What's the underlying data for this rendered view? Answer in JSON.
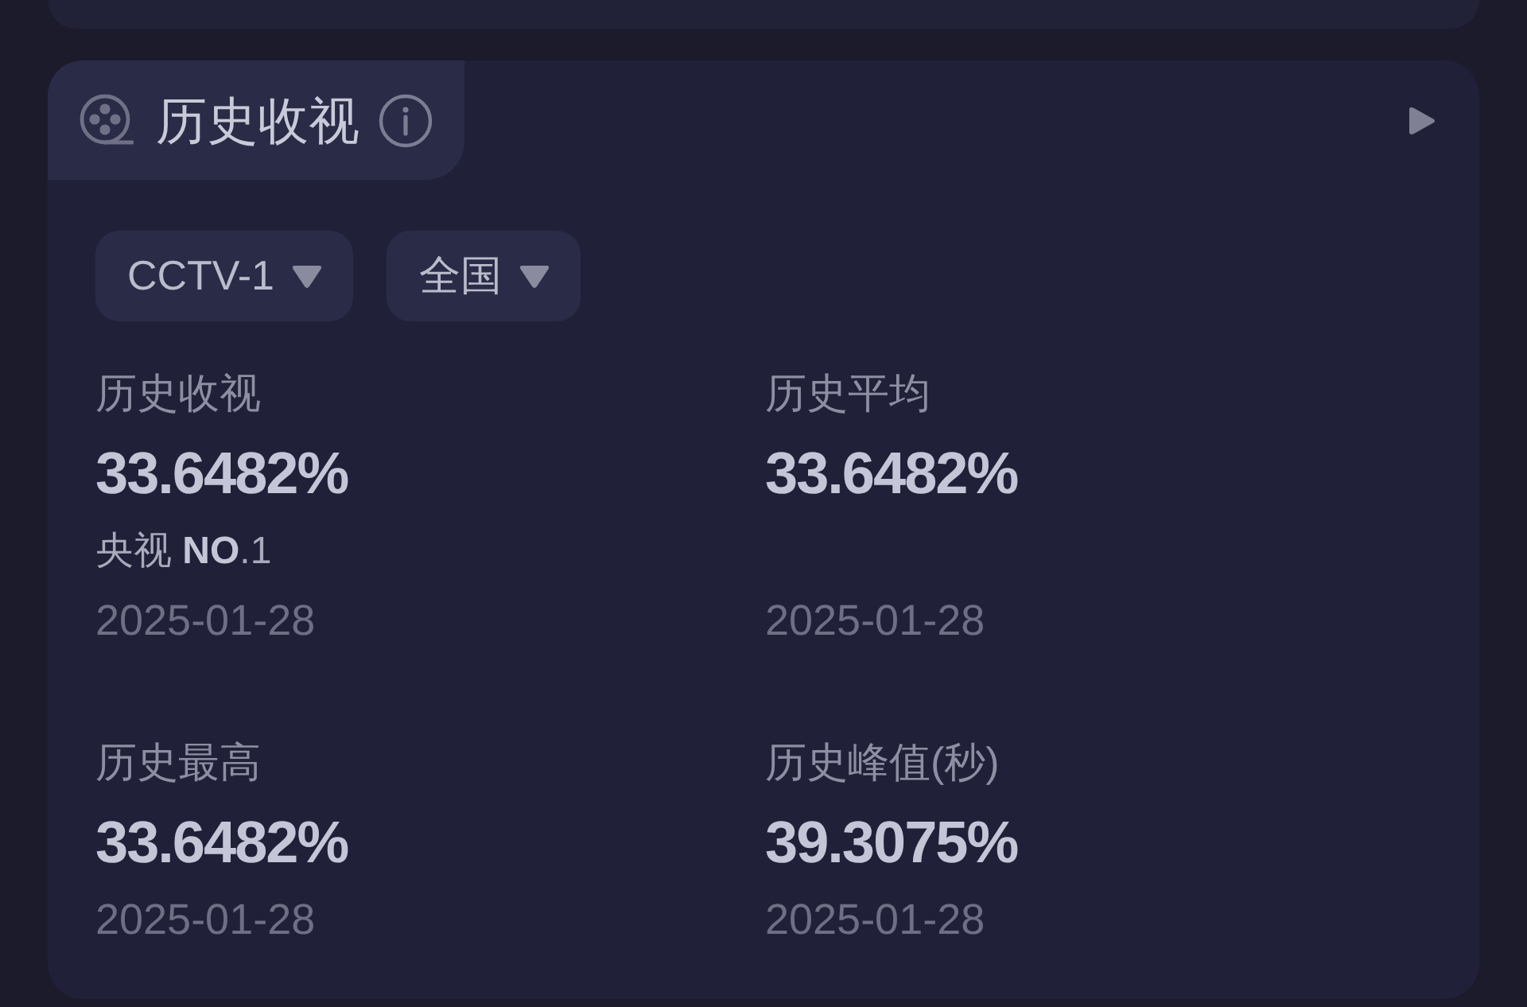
{
  "panel": {
    "title": "历史收视",
    "filters": [
      {
        "label": "CCTV-1"
      },
      {
        "label": "全国"
      }
    ],
    "stats": [
      {
        "label": "历史收视",
        "value": "33.6482%",
        "rank": "央视 **NO**.1",
        "date": "2025-01-28"
      },
      {
        "label": "历史平均",
        "value": "33.6482%",
        "date": "2025-01-28"
      },
      {
        "label": "历史最高",
        "value": "33.6482%",
        "date": "2025-01-28"
      },
      {
        "label": "历史峰值(秒)",
        "value": "39.3075%",
        "date": "2025-01-28"
      }
    ]
  }
}
